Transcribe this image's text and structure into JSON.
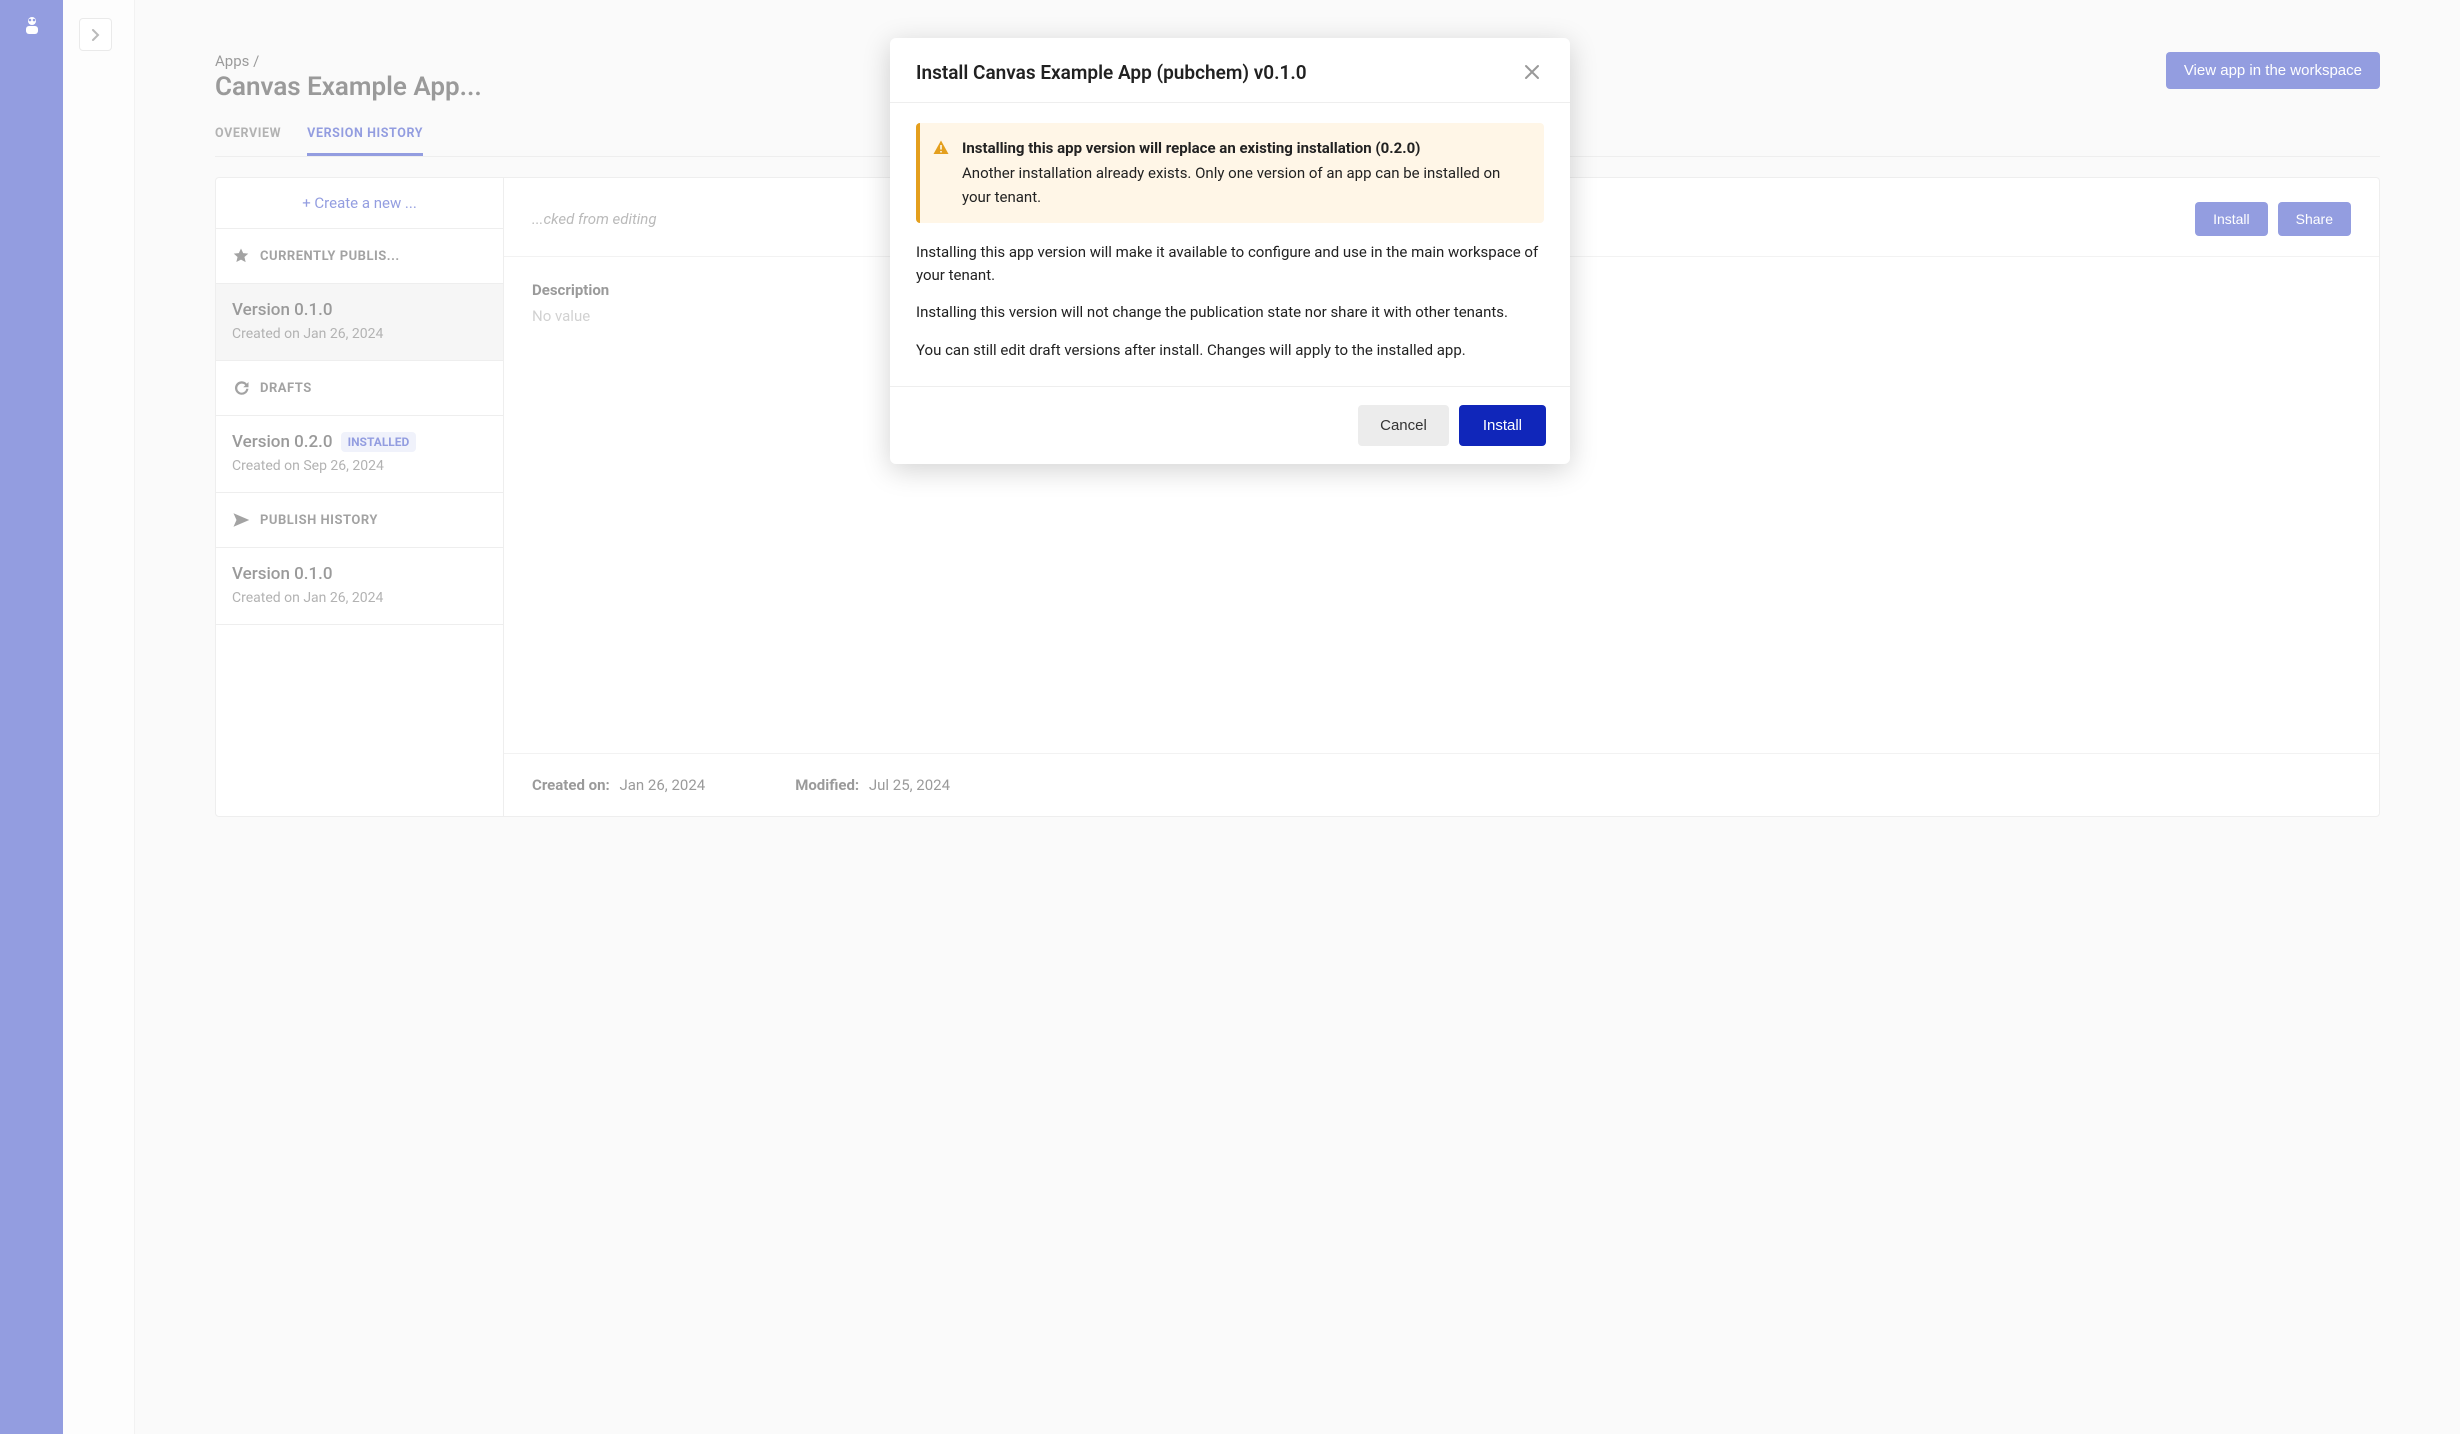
{
  "breadcrumb": "Apps /",
  "page_title": "Canvas Example App...",
  "header": {
    "view_btn": "View app in the workspace"
  },
  "tabs": {
    "overview": "OVERVIEW",
    "history": "VERSION HISTORY"
  },
  "version_list": {
    "create_link": "+ Create a new ...",
    "section_published": "CURRENTLY PUBLIS...",
    "published_item": {
      "name": "Version 0.1.0",
      "date": "Created on Jan 26, 2024"
    },
    "section_drafts": "DRAFTS",
    "draft_item": {
      "name": "Version 0.2.0",
      "badge": "INSTALLED",
      "date": "Created on Sep 26, 2024"
    },
    "section_pubhist": "PUBLISH HISTORY",
    "pubhist_item": {
      "name": "Version 0.1.0",
      "date": "Created on Jan 26, 2024"
    }
  },
  "detail": {
    "locked": "...cked from editing",
    "install_btn": "Install",
    "share_btn": "Share",
    "desc_label": "Description",
    "desc_value": "No value",
    "created_label": "Created on:",
    "created_value": "Jan 26, 2024",
    "modified_label": "Modified:",
    "modified_value": "Jul 25, 2024"
  },
  "modal": {
    "title": "Install Canvas Example App (pubchem) v0.1.0",
    "warn_heading": "Installing this app version will replace an existing installation (0.2.0)",
    "warn_body": "Another installation already exists. Only one version of an app can be installed on your tenant.",
    "p1": "Installing this app version will make it available to configure and use in the main workspace of your tenant.",
    "p2": "Installing this version will not change the publication state nor share it with other tenants.",
    "p3": "You can still edit draft versions after install. Changes will apply to the installed app.",
    "cancel": "Cancel",
    "install": "Install"
  }
}
